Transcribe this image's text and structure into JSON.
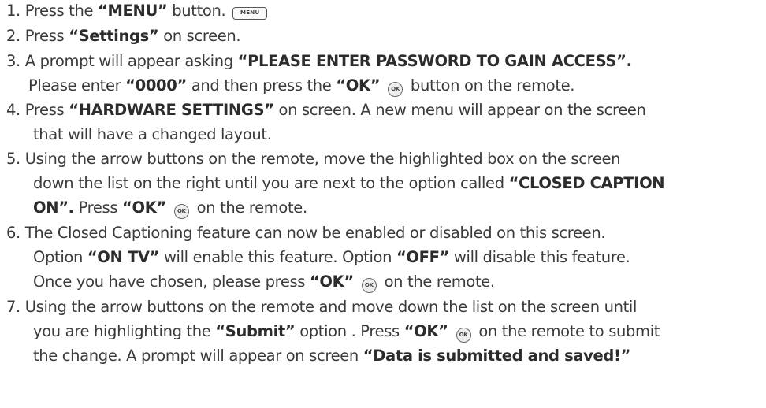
{
  "steps": [
    {
      "lines": [
        {
          "parts": [
            "1. Press the ",
            "“MENU”",
            " button."
          ]
        }
      ],
      "menu_icon_label": "MENU"
    },
    {
      "lines": [
        {
          "parts": [
            "2. Press ",
            "“Settings”",
            " on screen."
          ]
        }
      ]
    },
    {
      "lines": [
        {
          "parts": [
            "3. A prompt will appear asking ",
            "“PLEASE ENTER PASSWORD TO GAIN ACCESS”."
          ]
        },
        {
          "parts": [
            "Please enter ",
            "“0000”",
            " and then press the ",
            "“OK”",
            " button on the remote."
          ]
        }
      ]
    },
    {
      "lines": [
        {
          "parts": [
            "4. Press ",
            "“HARDWARE SETTINGS”",
            " on screen. A new menu will appear on the screen"
          ]
        },
        {
          "parts": [
            "that will have a changed layout."
          ]
        }
      ]
    },
    {
      "lines": [
        {
          "parts": [
            "5. Using the arrow buttons on the remote, move the highlighted box on the screen"
          ]
        },
        {
          "parts": [
            "down the list on the right until you are next to the option called ",
            "“CLOSED CAPTION"
          ]
        },
        {
          "parts": [
            "ON”.",
            " Press ",
            "“OK”",
            " on the remote."
          ]
        }
      ]
    },
    {
      "lines": [
        {
          "parts": [
            "6. The Closed Captioning feature can now be enabled or disabled on this screen."
          ]
        },
        {
          "parts": [
            "Option ",
            "“ON TV”",
            " will enable this feature. Option ",
            "“OFF”",
            " will disable this feature."
          ]
        },
        {
          "parts": [
            "Once you have chosen, please press ",
            "“OK”",
            " on the remote."
          ]
        }
      ]
    },
    {
      "lines": [
        {
          "parts": [
            "7. Using the arrow buttons on the remote and move down the list on the screen until"
          ]
        },
        {
          "parts": [
            "you are highlighting the ",
            "“Submit”",
            " option . Press ",
            "“OK”",
            " on the remote to submit"
          ]
        },
        {
          "parts": [
            "the change. A prompt will appear on screen ",
            "“Data is submitted and saved!”"
          ]
        }
      ]
    }
  ],
  "ok_icon_label": "OK"
}
